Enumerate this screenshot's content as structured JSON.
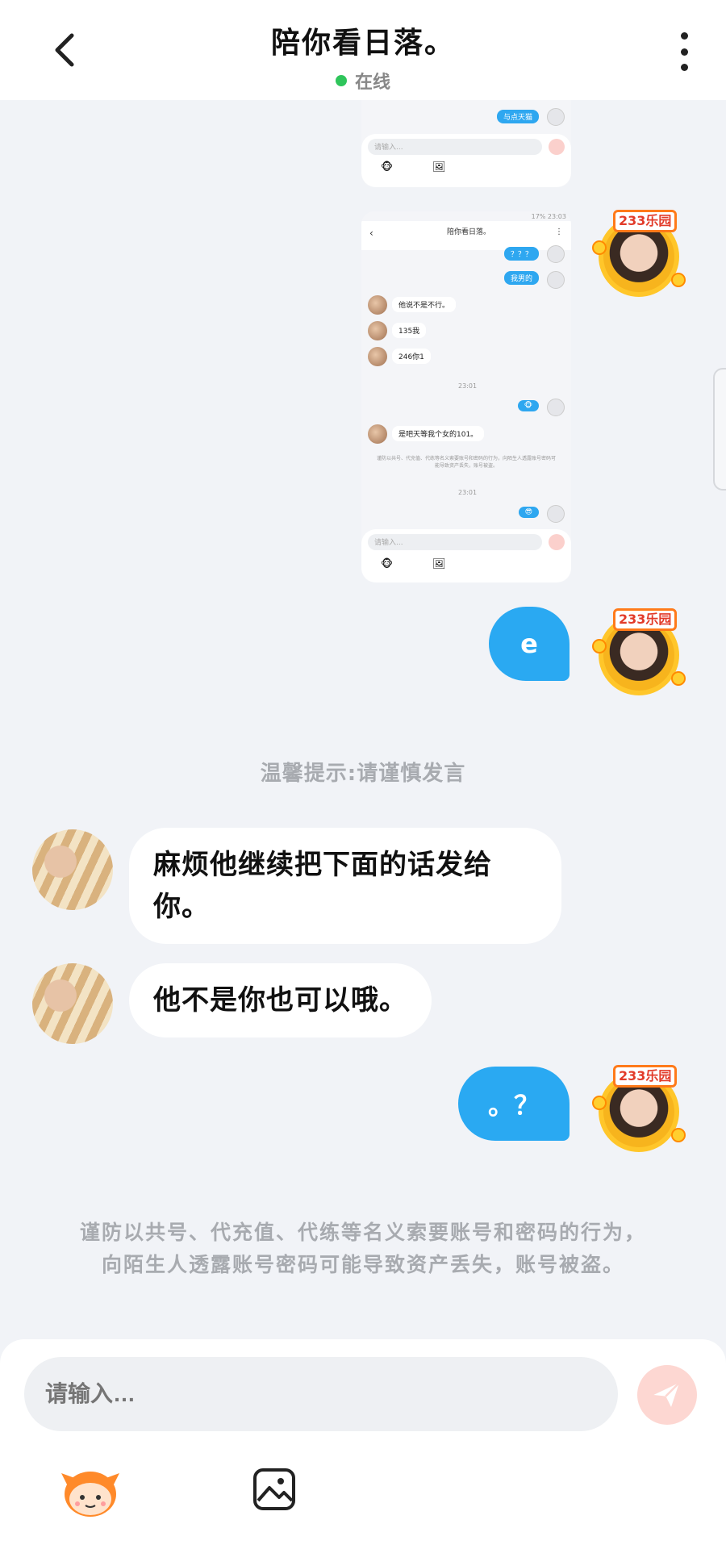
{
  "header": {
    "title": "陪你看日落。",
    "status": "在线"
  },
  "shot1": {
    "bubble": "与点天猫",
    "placeholder": "请输入..."
  },
  "shot2": {
    "status_bar": "17% 23:03",
    "title": "陪你看日落。",
    "bubble_q": "？？？",
    "bubble_2": "我男的",
    "msg1": "他说不是不行。",
    "msg2": "135我",
    "msg3": "246你1",
    "time1": "23:01",
    "msg4": "是吧天等我个女的101。",
    "warning": "谨防以共号、代充值、代练等名义索要账号和密码的行为，向陌生人透露账号密码可能导致资产丢失，账号被盗。",
    "time2": "23:01",
    "placeholder": "请输入..."
  },
  "messages": {
    "sent_e": "e",
    "tip": "温馨提示:请谨慎发言",
    "recv1": "麻烦他继续把下面的话发给你。",
    "recv2": "他不是你也可以哦。",
    "sent_q": "。？",
    "warning": "谨防以共号、代充值、代练等名义索要账号和密码的行为，向陌生人透露账号密码可能导致资产丢失，账号被盗。"
  },
  "avatar_badge": "233乐园",
  "input": {
    "placeholder": "请输入…"
  },
  "colors": {
    "accent_blue": "#2aa9f2",
    "online_green": "#2fc55b",
    "send_pink": "#fdd7d2"
  },
  "icons": [
    "back-arrow-icon",
    "more-vertical-icon",
    "send-icon",
    "emoji-mascot-icon",
    "image-icon"
  ]
}
